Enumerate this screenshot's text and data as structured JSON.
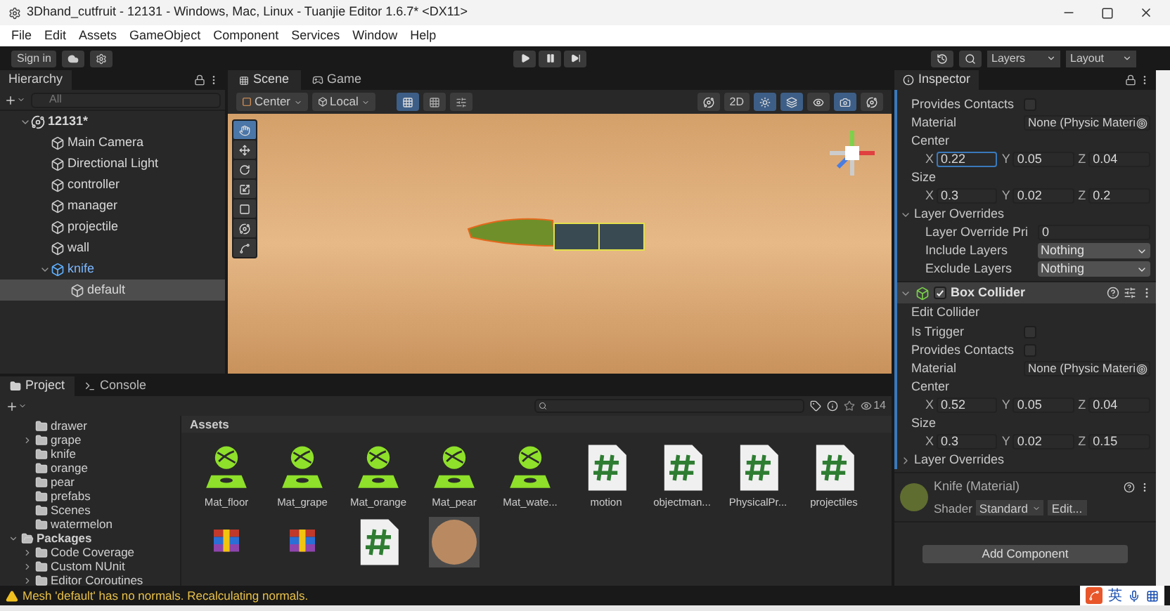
{
  "window": {
    "title": "3Dhand_cutfruit - 12131 - Windows, Mac, Linux - Tuanjie Editor 1.6.7* <DX11>"
  },
  "menu": [
    "File",
    "Edit",
    "Assets",
    "GameObject",
    "Component",
    "Services",
    "Window",
    "Help"
  ],
  "toolbar": {
    "sign_in": "Sign in",
    "layers": "Layers",
    "layout": "Layout"
  },
  "hierarchy": {
    "title": "Hierarchy",
    "search": {
      "placeholder": "All"
    },
    "tree": [
      {
        "label": "12131*",
        "kind": "scene",
        "expanded": true,
        "selected": false,
        "children": [
          {
            "label": "Main Camera",
            "kind": "object",
            "selected": false
          },
          {
            "label": "Directional Light",
            "kind": "object",
            "selected": false
          },
          {
            "label": "controller",
            "kind": "object",
            "selected": false
          },
          {
            "label": "manager",
            "kind": "object",
            "selected": false
          },
          {
            "label": "projectile",
            "kind": "object",
            "selected": false
          },
          {
            "label": "wall",
            "kind": "object",
            "selected": false
          },
          {
            "label": "knife",
            "kind": "prefab",
            "expanded": true,
            "selected": false,
            "children": [
              {
                "label": "default",
                "kind": "object",
                "selected": true
              }
            ]
          }
        ]
      }
    ]
  },
  "scene": {
    "tabs": [
      {
        "label": "Scene",
        "selected": true
      },
      {
        "label": "Game",
        "selected": false
      }
    ],
    "pivot": "Center",
    "space": "Local",
    "mode_2d": "2D",
    "tools": [
      {
        "kind": "hand",
        "selected": true
      },
      {
        "kind": "move",
        "selected": false
      },
      {
        "kind": "rotate",
        "selected": false
      },
      {
        "kind": "scale",
        "selected": false
      },
      {
        "kind": "rect",
        "selected": false
      },
      {
        "kind": "transform",
        "selected": false
      },
      {
        "kind": "custom",
        "selected": false
      }
    ]
  },
  "inspector": {
    "title": "Inspector",
    "rows": [
      {
        "kind": "checkbox",
        "label": "Provides Contacts",
        "checked": false
      },
      {
        "kind": "object",
        "label": "Material",
        "value": "None (Physic Materi"
      },
      {
        "kind": "label",
        "label": "Center"
      },
      {
        "kind": "vector",
        "fields": [
          {
            "axis": "X",
            "value": "0.22",
            "focused": true
          },
          {
            "axis": "Y",
            "value": "0.05",
            "focused": false
          },
          {
            "axis": "Z",
            "value": "0.04",
            "focused": false
          }
        ]
      },
      {
        "kind": "label",
        "label": "Size"
      },
      {
        "kind": "vector",
        "fields": [
          {
            "axis": "X",
            "value": "0.3",
            "focused": false
          },
          {
            "axis": "Y",
            "value": "0.02",
            "focused": false
          },
          {
            "axis": "Z",
            "value": "0.2",
            "focused": false
          }
        ]
      },
      {
        "kind": "foldout",
        "label": "Layer Overrides",
        "expanded": true,
        "children": [
          {
            "kind": "text_field",
            "label": "Layer Override Pri",
            "value": "0"
          },
          {
            "kind": "dropdown",
            "label": "Include Layers",
            "value": "Nothing"
          },
          {
            "kind": "dropdown",
            "label": "Exclude Layers",
            "value": "Nothing"
          }
        ]
      },
      {
        "kind": "component",
        "label": "Box Collider",
        "enabled": true
      },
      {
        "kind": "button",
        "label": "Edit Collider"
      },
      {
        "kind": "checkbox",
        "label": "Is Trigger",
        "checked": false
      },
      {
        "kind": "checkbox",
        "label": "Provides Contacts",
        "checked": false
      },
      {
        "kind": "object",
        "label": "Material",
        "value": "None (Physic Materi"
      },
      {
        "kind": "label",
        "label": "Center"
      },
      {
        "kind": "vector",
        "fields": [
          {
            "axis": "X",
            "value": "0.52",
            "focused": false
          },
          {
            "axis": "Y",
            "value": "0.05",
            "focused": false
          },
          {
            "axis": "Z",
            "value": "0.04",
            "focused": false
          }
        ]
      },
      {
        "kind": "label",
        "label": "Size"
      },
      {
        "kind": "vector",
        "fields": [
          {
            "axis": "X",
            "value": "0.3",
            "focused": false
          },
          {
            "axis": "Y",
            "value": "0.02",
            "focused": false
          },
          {
            "axis": "Z",
            "value": "0.15",
            "focused": false
          }
        ]
      },
      {
        "kind": "foldout",
        "label": "Layer Overrides",
        "expanded": false
      }
    ],
    "material": {
      "name": "Knife (Material)",
      "shader_label": "Shader",
      "shader": "Standard",
      "edit": "Edit..."
    },
    "add_component": "Add Component"
  },
  "project": {
    "tabs": [
      {
        "label": "Project",
        "selected": true
      },
      {
        "label": "Console",
        "selected": false
      }
    ],
    "tree": [
      {
        "label": "drawer"
      },
      {
        "label": "grape",
        "expanded": false
      },
      {
        "label": "knife"
      },
      {
        "label": "orange"
      },
      {
        "label": "pear"
      },
      {
        "label": "prefabs"
      },
      {
        "label": "Scenes"
      },
      {
        "label": "watermelon"
      },
      {
        "label": "Packages",
        "expanded": true,
        "root": true,
        "children": [
          {
            "label": "Code Coverage",
            "expanded": false
          },
          {
            "label": "Custom NUnit",
            "expanded": false
          },
          {
            "label": "Editor Coroutines",
            "expanded": false
          }
        ]
      }
    ],
    "hidden_count": "14",
    "breadcrumb": "Assets",
    "assets": [
      {
        "kind": "material",
        "name": "Mat_floor"
      },
      {
        "kind": "material",
        "name": "Mat_grape"
      },
      {
        "kind": "material",
        "name": "Mat_orange"
      },
      {
        "kind": "material",
        "name": "Mat_pear"
      },
      {
        "kind": "material",
        "name": "Mat_wate..."
      },
      {
        "kind": "script",
        "name": "motion"
      },
      {
        "kind": "script",
        "name": "objectman..."
      },
      {
        "kind": "script",
        "name": "PhysicalPr..."
      },
      {
        "kind": "script",
        "name": "projectiles"
      },
      {
        "kind": "archive"
      },
      {
        "kind": "archive"
      },
      {
        "kind": "script"
      },
      {
        "kind": "texture"
      }
    ]
  },
  "status": {
    "message": "Mesh 'default' has no normals. Recalculating normals."
  },
  "ime": {
    "label": "英"
  }
}
